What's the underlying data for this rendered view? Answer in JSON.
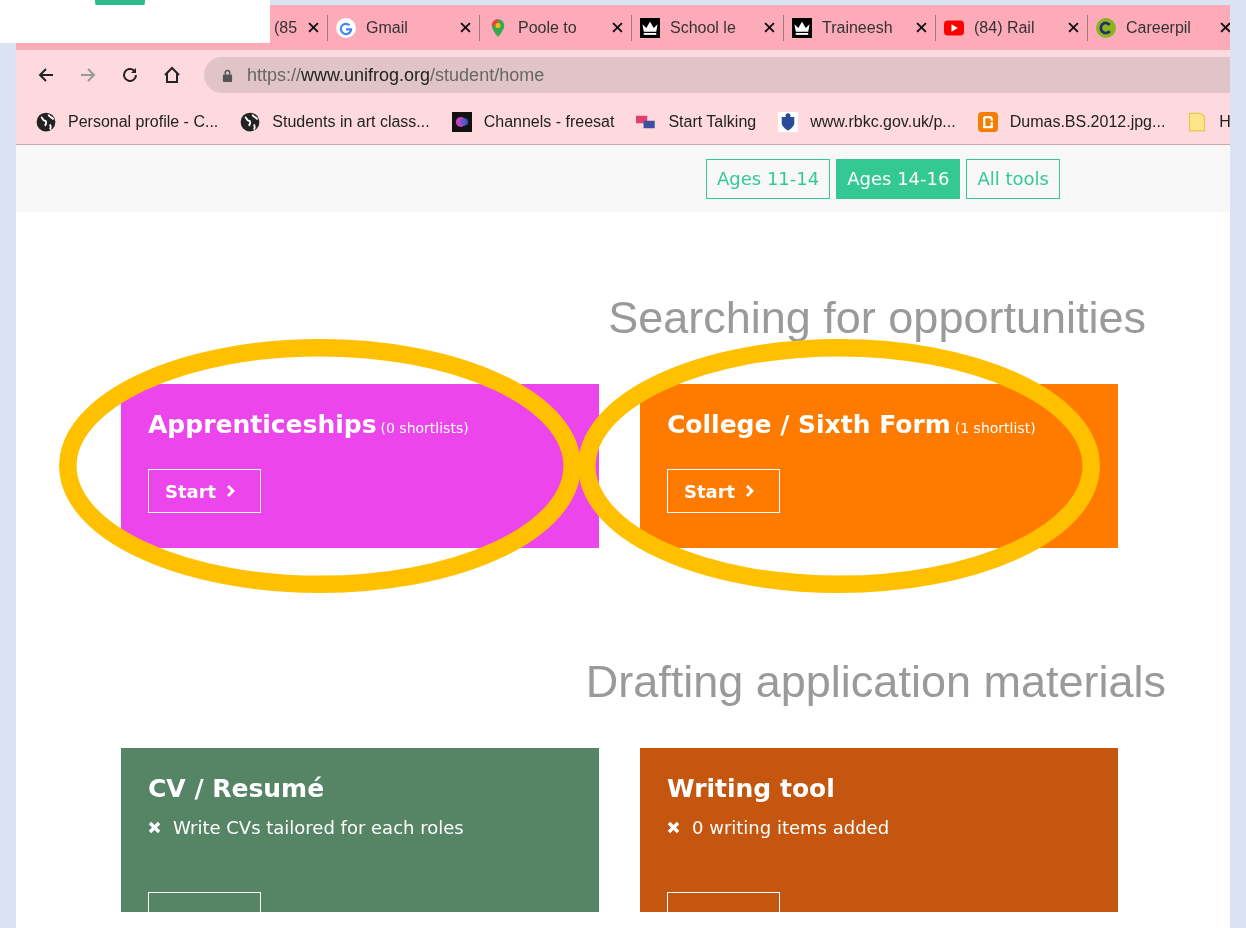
{
  "tabs": [
    {
      "title": "(85",
      "kind": "plain"
    },
    {
      "title": "Gmail",
      "kind": "google"
    },
    {
      "title": "Poole to",
      "kind": "pin"
    },
    {
      "title": "School le",
      "kind": "crown"
    },
    {
      "title": "Traineesh",
      "kind": "crown"
    },
    {
      "title": "(84) Rail",
      "kind": "video"
    },
    {
      "title": "Careerpil",
      "kind": "letter"
    }
  ],
  "toolbar": {
    "forward_disabled": true,
    "url": "https://www.unifrog.org/student/home"
  },
  "bookmarks": [
    {
      "title": "Personal profile - C...",
      "kind": "globe"
    },
    {
      "title": "Students in art class...",
      "kind": "globe"
    },
    {
      "title": "Channels - freesat",
      "kind": "blob"
    },
    {
      "title": "Start Talking",
      "kind": "chat"
    },
    {
      "title": "www.rbkc.gov.uk/p...",
      "kind": "crest"
    },
    {
      "title": "Dumas.BS.2012.jpg...",
      "kind": "blogger"
    },
    {
      "title": "H",
      "kind": "note"
    }
  ],
  "age_filters": [
    {
      "label": "Ages 11-14",
      "selected": false
    },
    {
      "label": "Ages 14-16",
      "selected": true
    },
    {
      "label": "All tools",
      "selected": false
    }
  ],
  "sections": [
    {
      "title": "Searching for opportunities",
      "cards": [
        {
          "title": "Apprenticeships",
          "note": "(0 shortlists)",
          "color": "#ec45ec",
          "button": "Start",
          "circled": true
        },
        {
          "title": "College / Sixth Form",
          "note": "(1 shortlist)",
          "color": "#ff7b00",
          "button": "Start",
          "circled": true
        }
      ]
    },
    {
      "title": "Drafting application materials",
      "cards": [
        {
          "title": "CV / Resumé",
          "item": "Write CVs tailored for each roles",
          "color": "#568565",
          "button_cut_off": true,
          "circled": false
        },
        {
          "title": "Writing tool",
          "item": "0 writing items added",
          "color": "#c55610",
          "button_cut_off": true,
          "circled": false
        }
      ]
    }
  ]
}
